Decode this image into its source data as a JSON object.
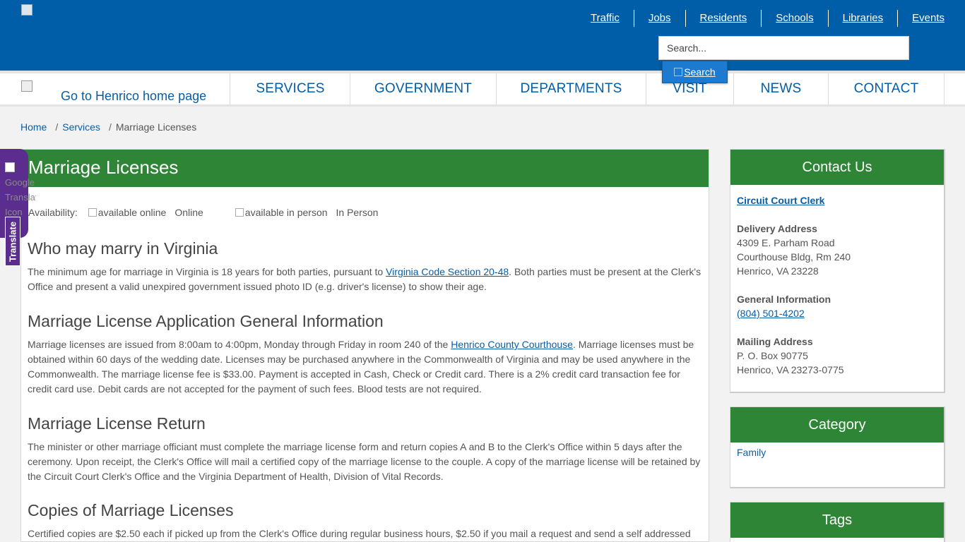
{
  "header": {
    "top_links": [
      "Traffic",
      "Jobs",
      "Residents",
      "Schools",
      "Libraries",
      "Events"
    ],
    "search_placeholder": "Search...",
    "search_button": "Search"
  },
  "nav": {
    "home_link": "Go to Henrico home page",
    "items": [
      "SERVICES",
      "GOVERNMENT",
      "DEPARTMENTS",
      "VISIT",
      "NEWS",
      "CONTACT"
    ]
  },
  "breadcrumb": {
    "home": "Home",
    "sep": "/",
    "services": "Services",
    "current": "Marriage Licenses"
  },
  "translate": {
    "icon_alt": "Google Translate Icon",
    "label": "Translate"
  },
  "content": {
    "title": "Marriage Licenses",
    "availability_label": "Availability:",
    "online_alt": "available online",
    "online_text": "Online",
    "inperson_alt": "available in person",
    "inperson_text": "In Person",
    "sections": [
      {
        "heading": "Who may marry in Virginia",
        "p_before": "The minimum age for marriage in Virginia is 18 years for both parties, pursuant to ",
        "link": "Virginia Code Section 20-48",
        "p_after": ". Both parties must be present at the Clerk's Office and present a valid unexpired government issued photo ID (e.g. driver's license) to show their age."
      },
      {
        "heading": "Marriage License Application General Information",
        "p_before": "Marriage licenses are issued from 8:00am to 4:00pm, Monday through Friday in room 240 of the ",
        "link": "Henrico County Courthouse",
        "p_after": ". Marriage licenses must be obtained within 60 days of the wedding date. Licenses may be purchased anywhere in the Commonwealth of Virginia and may be used anywhere in the Commonwealth. The marriage license fee is $33.00. Payment is accepted in Cash, Check or Credit card. There is a 2% credit card transaction fee for credit card use. Debit cards are not accepted for the payment of such fees. Blood tests are not required."
      },
      {
        "heading": "Marriage License Return",
        "text": "The minister or other marriage officiant must complete the marriage license form and return copies A and B to the Clerk's Office within 5 days after the ceremony. Upon receipt, the Clerk's Office will mail a certified copy of the marriage license to the couple. A copy of the marriage license will be retained by the Circuit Court Clerk's Office and the Virginia Department of Health, Division of Vital Records."
      },
      {
        "heading": "Copies of Marriage Licenses",
        "text": "Certified copies are $2.50 each if picked up from the Clerk's Office during regular business hours, $2.50 if you mail a request and send a self addressed"
      }
    ]
  },
  "sidebar": {
    "contact": {
      "title": "Contact Us",
      "office": "Circuit Court Clerk",
      "delivery_label": "Delivery Address",
      "delivery_lines": [
        "4309 E. Parham Road",
        "Courthouse Bldg, Rm 240",
        "Henrico, VA 23228"
      ],
      "general_label": "General Information",
      "phone": "(804) 501-4202",
      "mailing_label": "Mailing Address",
      "mailing_lines": [
        "P. O. Box 90775",
        "Henrico, VA 23273-0775"
      ]
    },
    "category": {
      "title": "Category",
      "items": [
        "Family"
      ]
    },
    "tags": {
      "title": "Tags"
    }
  },
  "colors": {
    "header_blue": "#005da7",
    "section_green": "#2e8536",
    "translate_purple": "#5a2d8f",
    "link_blue": "#0a5da3"
  }
}
